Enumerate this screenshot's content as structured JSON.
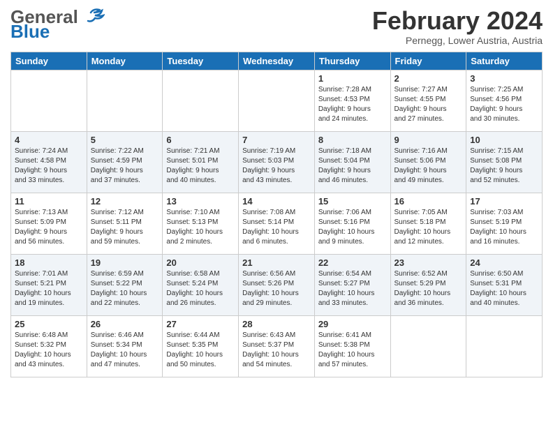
{
  "header": {
    "logo_general": "General",
    "logo_blue": "Blue",
    "month": "February 2024",
    "location": "Pernegg, Lower Austria, Austria"
  },
  "weekdays": [
    "Sunday",
    "Monday",
    "Tuesday",
    "Wednesday",
    "Thursday",
    "Friday",
    "Saturday"
  ],
  "weeks": [
    [
      {
        "day": "",
        "info": ""
      },
      {
        "day": "",
        "info": ""
      },
      {
        "day": "",
        "info": ""
      },
      {
        "day": "",
        "info": ""
      },
      {
        "day": "1",
        "info": "Sunrise: 7:28 AM\nSunset: 4:53 PM\nDaylight: 9 hours\nand 24 minutes."
      },
      {
        "day": "2",
        "info": "Sunrise: 7:27 AM\nSunset: 4:55 PM\nDaylight: 9 hours\nand 27 minutes."
      },
      {
        "day": "3",
        "info": "Sunrise: 7:25 AM\nSunset: 4:56 PM\nDaylight: 9 hours\nand 30 minutes."
      }
    ],
    [
      {
        "day": "4",
        "info": "Sunrise: 7:24 AM\nSunset: 4:58 PM\nDaylight: 9 hours\nand 33 minutes."
      },
      {
        "day": "5",
        "info": "Sunrise: 7:22 AM\nSunset: 4:59 PM\nDaylight: 9 hours\nand 37 minutes."
      },
      {
        "day": "6",
        "info": "Sunrise: 7:21 AM\nSunset: 5:01 PM\nDaylight: 9 hours\nand 40 minutes."
      },
      {
        "day": "7",
        "info": "Sunrise: 7:19 AM\nSunset: 5:03 PM\nDaylight: 9 hours\nand 43 minutes."
      },
      {
        "day": "8",
        "info": "Sunrise: 7:18 AM\nSunset: 5:04 PM\nDaylight: 9 hours\nand 46 minutes."
      },
      {
        "day": "9",
        "info": "Sunrise: 7:16 AM\nSunset: 5:06 PM\nDaylight: 9 hours\nand 49 minutes."
      },
      {
        "day": "10",
        "info": "Sunrise: 7:15 AM\nSunset: 5:08 PM\nDaylight: 9 hours\nand 52 minutes."
      }
    ],
    [
      {
        "day": "11",
        "info": "Sunrise: 7:13 AM\nSunset: 5:09 PM\nDaylight: 9 hours\nand 56 minutes."
      },
      {
        "day": "12",
        "info": "Sunrise: 7:12 AM\nSunset: 5:11 PM\nDaylight: 9 hours\nand 59 minutes."
      },
      {
        "day": "13",
        "info": "Sunrise: 7:10 AM\nSunset: 5:13 PM\nDaylight: 10 hours\nand 2 minutes."
      },
      {
        "day": "14",
        "info": "Sunrise: 7:08 AM\nSunset: 5:14 PM\nDaylight: 10 hours\nand 6 minutes."
      },
      {
        "day": "15",
        "info": "Sunrise: 7:06 AM\nSunset: 5:16 PM\nDaylight: 10 hours\nand 9 minutes."
      },
      {
        "day": "16",
        "info": "Sunrise: 7:05 AM\nSunset: 5:18 PM\nDaylight: 10 hours\nand 12 minutes."
      },
      {
        "day": "17",
        "info": "Sunrise: 7:03 AM\nSunset: 5:19 PM\nDaylight: 10 hours\nand 16 minutes."
      }
    ],
    [
      {
        "day": "18",
        "info": "Sunrise: 7:01 AM\nSunset: 5:21 PM\nDaylight: 10 hours\nand 19 minutes."
      },
      {
        "day": "19",
        "info": "Sunrise: 6:59 AM\nSunset: 5:22 PM\nDaylight: 10 hours\nand 22 minutes."
      },
      {
        "day": "20",
        "info": "Sunrise: 6:58 AM\nSunset: 5:24 PM\nDaylight: 10 hours\nand 26 minutes."
      },
      {
        "day": "21",
        "info": "Sunrise: 6:56 AM\nSunset: 5:26 PM\nDaylight: 10 hours\nand 29 minutes."
      },
      {
        "day": "22",
        "info": "Sunrise: 6:54 AM\nSunset: 5:27 PM\nDaylight: 10 hours\nand 33 minutes."
      },
      {
        "day": "23",
        "info": "Sunrise: 6:52 AM\nSunset: 5:29 PM\nDaylight: 10 hours\nand 36 minutes."
      },
      {
        "day": "24",
        "info": "Sunrise: 6:50 AM\nSunset: 5:31 PM\nDaylight: 10 hours\nand 40 minutes."
      }
    ],
    [
      {
        "day": "25",
        "info": "Sunrise: 6:48 AM\nSunset: 5:32 PM\nDaylight: 10 hours\nand 43 minutes."
      },
      {
        "day": "26",
        "info": "Sunrise: 6:46 AM\nSunset: 5:34 PM\nDaylight: 10 hours\nand 47 minutes."
      },
      {
        "day": "27",
        "info": "Sunrise: 6:44 AM\nSunset: 5:35 PM\nDaylight: 10 hours\nand 50 minutes."
      },
      {
        "day": "28",
        "info": "Sunrise: 6:43 AM\nSunset: 5:37 PM\nDaylight: 10 hours\nand 54 minutes."
      },
      {
        "day": "29",
        "info": "Sunrise: 6:41 AM\nSunset: 5:38 PM\nDaylight: 10 hours\nand 57 minutes."
      },
      {
        "day": "",
        "info": ""
      },
      {
        "day": "",
        "info": ""
      }
    ]
  ]
}
